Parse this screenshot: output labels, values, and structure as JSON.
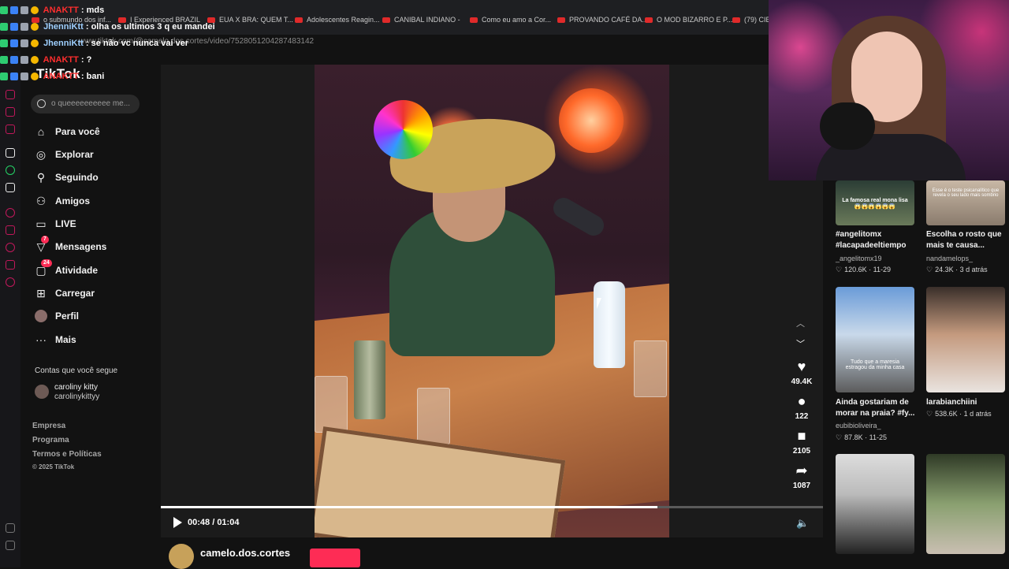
{
  "browser": {
    "bookmarks": [
      "o submundo dos inf...",
      "I Experienced BRAZIL",
      "EUA X BRA: QUEM T...",
      "Adolescentes Reagin...",
      "CANIBAL INDIANO -",
      "Como eu amo a Cor...",
      "PROVANDO CAFÉ DA...",
      "O MOD BIZARRO E P...",
      "(79) CIE"
    ],
    "url": "www.tiktok.com/@camelo.dos.cortes/video/7528051204287483142"
  },
  "chat": [
    {
      "user": "ANAKTT",
      "color": "#ff2e2e",
      "message": "mds"
    },
    {
      "user": "JhenniKtt",
      "color": "#9fd0ff",
      "message": "olha os ultimos 3 q eu mandei"
    },
    {
      "user": "JhenniKtt",
      "color": "#9fd0ff",
      "message": "se não vc nunca vai ver"
    },
    {
      "user": "ANAKTT",
      "color": "#ff2e2e",
      "message": "?"
    },
    {
      "user": "ANAKTT",
      "color": "#ff2e2e",
      "message": "bani"
    }
  ],
  "sidebar": {
    "logo": "TikTok",
    "search_placeholder": "o queeeeeeeeee me...",
    "items": [
      {
        "label": "Para você",
        "icon": "home-icon"
      },
      {
        "label": "Explorar",
        "icon": "compass-icon"
      },
      {
        "label": "Seguindo",
        "icon": "following-icon"
      },
      {
        "label": "Amigos",
        "icon": "friends-icon"
      },
      {
        "label": "LIVE",
        "icon": "live-icon"
      },
      {
        "label": "Mensagens",
        "icon": "messages-icon",
        "badge": "7"
      },
      {
        "label": "Atividade",
        "icon": "activity-icon",
        "badge": "24"
      },
      {
        "label": "Carregar",
        "icon": "upload-icon"
      },
      {
        "label": "Perfil",
        "icon": "profile-icon"
      },
      {
        "label": "Mais",
        "icon": "more-icon"
      }
    ],
    "following_title": "Contas que você segue",
    "following": [
      {
        "name": "caroliny kitty",
        "handle": "carolinykittyy"
      }
    ],
    "footer": [
      "Empresa",
      "Programa",
      "Termos e Políticas",
      "© 2025 TikTok"
    ]
  },
  "player": {
    "time_current": "00:48",
    "time_total": "01:04",
    "progress": 0.75,
    "author": "camelo.dos.cortes",
    "actions": {
      "likes": "49.4K",
      "comments": "122",
      "saves": "2105",
      "shares": "1087"
    }
  },
  "recommendations": [
    {
      "title": "#angelitomx #lacapadeeltiempo",
      "author": "_angelitomx19",
      "likes": "120.6K",
      "date": "11-29",
      "caption": "La famosa real mona lisa 😱😱😱😱😱😱"
    },
    {
      "title": "Escolha o rosto que mais te causa...",
      "author": "nandamelops_",
      "likes": "24.3K",
      "date": "3 d atrás",
      "caption": "Esse é o teste psicanalítico que revela o seu lado mais sombrio"
    },
    {
      "title": "Ainda gostariam de morar na praia? #fy...",
      "author": "eubibioliveira_",
      "likes": "87.8K",
      "date": "11-25",
      "caption": "Tudo que a maresia estragou da minha casa"
    },
    {
      "title": "larabianchiini",
      "author": "",
      "likes": "538.6K",
      "date": "1 d atrás",
      "caption": ""
    }
  ],
  "colors": {
    "accent": "#fe2c55",
    "bg": "#121212"
  }
}
